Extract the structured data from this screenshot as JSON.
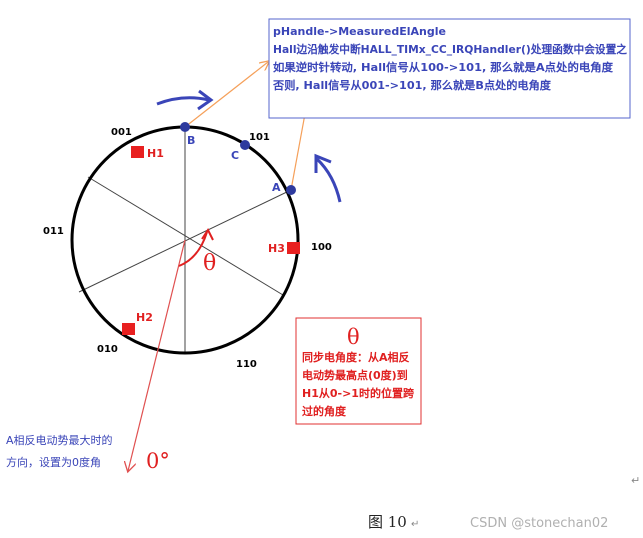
{
  "colors": {
    "circle": "#000000",
    "dividers": "#444444",
    "point": "#2e3a9e",
    "blue_text": "#3a45b8",
    "red_text": "#e02020",
    "hall_square": "#e82020",
    "orange_arrow": "#f5a05a",
    "note_border": "#5566cc",
    "red_border": "#e03030",
    "red_line": "#e05050",
    "watermark": "#b0b0b0",
    "caption": "#222222"
  },
  "top_note": {
    "line1": "pHandle->MeasuredElAngle",
    "line2": "Hall边沿触发中断HALL_TIMx_CC_IRQHandler()处理函数中会设置之",
    "line3": "如果逆时针转动, Hall信号从100->101, 那么就是A点处的电角度",
    "line4": "否则, Hall信号从001->101, 那么就是B点处的电角度"
  },
  "sector_codes": {
    "s001": "001",
    "s101": "101",
    "s100": "100",
    "s110": "110",
    "s010": "010",
    "s011": "011"
  },
  "hall_sensors": {
    "h1": "H1",
    "h2": "H2",
    "h3": "H3"
  },
  "points": {
    "a": "A",
    "b": "B",
    "c": "C"
  },
  "theta_symbol": "θ",
  "sync_note": {
    "symbol": "θ",
    "line1": "同步电角度：从A相反",
    "line2": "电动势最高点(0度)到",
    "line3": "H1从0->1时的位置跨",
    "line4": "过的角度"
  },
  "zero_note": {
    "line1": "A相反电动势最大时的",
    "line2": "方向，设置为0度角"
  },
  "zero_label": "0°",
  "figure_caption": "图 10",
  "watermark": "CSDN @stonechan02"
}
